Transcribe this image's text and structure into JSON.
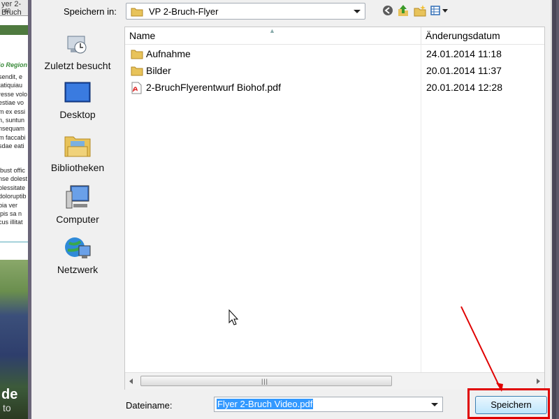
{
  "background_doc": {
    "ruler_title": "yer 2-Bruch",
    "ruler_number": "40",
    "subheading": "io Region",
    "text_lines_1": [
      "sendit, e",
      "tatiquiau",
      "resse volo",
      "estiae vo",
      "m ex essi",
      "n, suntun",
      "nsequam",
      "m faccabi",
      "sdae eati"
    ],
    "text_lines_2": [
      "ibust offic",
      "nse dolest",
      "olessitate",
      "doloruptib",
      "bia ver",
      "ipis sa n",
      "cus illitat"
    ],
    "photo_text_1": "de",
    "photo_text_2": "to"
  },
  "dialog": {
    "save_in_label": "Speichern in:",
    "current_folder": "VP 2-Bruch-Flyer",
    "toolbar": {
      "back_icon": "back-arrow-icon",
      "up_icon": "up-folder-icon",
      "new_folder_icon": "new-folder-icon",
      "view_icon": "view-menu-icon"
    },
    "places": [
      {
        "label": "Zuletzt besucht",
        "icon": "recent-places-icon"
      },
      {
        "label": "Desktop",
        "icon": "desktop-icon"
      },
      {
        "label": "Bibliotheken",
        "icon": "libraries-icon"
      },
      {
        "label": "Computer",
        "icon": "computer-icon"
      },
      {
        "label": "Netzwerk",
        "icon": "network-icon"
      }
    ],
    "columns": {
      "name": "Name",
      "date": "Änderungsdatum"
    },
    "files": [
      {
        "name": "Aufnahme",
        "date": "24.01.2014 11:18",
        "type": "folder"
      },
      {
        "name": "Bilder",
        "date": "20.01.2014 11:37",
        "type": "folder"
      },
      {
        "name": "2-BruchFlyerentwurf Biohof.pdf",
        "date": "20.01.2014 12:28",
        "type": "pdf"
      }
    ],
    "filename_label": "Dateiname:",
    "filename_value": "Flyer 2-Bruch Video.pdf",
    "save_button": "Speichern"
  },
  "annotation": {
    "highlight_color": "#e00000",
    "arrow_color": "#e00000"
  }
}
